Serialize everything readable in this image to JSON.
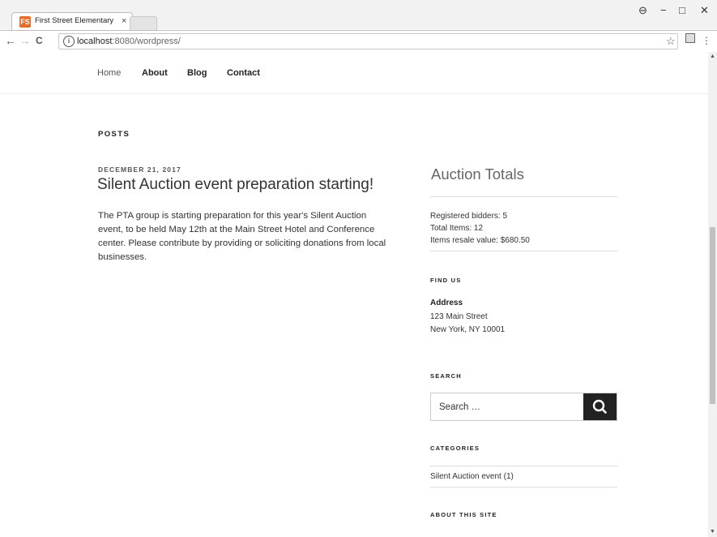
{
  "browser": {
    "tab_title": "First Street Elementary Sc",
    "tab_close": "×",
    "favicon_text": "FS",
    "url_host": "localhost",
    "url_path": ":8080/wordpress/",
    "back_glyph": "←",
    "forward_glyph": "→",
    "reload_glyph": "C",
    "info_glyph": "i",
    "star_glyph": "☆",
    "menu_glyph": "⋮",
    "profile_glyph": "⊖",
    "minimize_glyph": "−",
    "maximize_glyph": "□",
    "close_glyph": "✕"
  },
  "nav": {
    "items": [
      "Home",
      "About",
      "Blog",
      "Contact"
    ]
  },
  "main": {
    "section_title": "POSTS",
    "post": {
      "date": "DECEMBER 21, 2017",
      "title": "Silent Auction event preparation starting!",
      "body": "The PTA group is starting preparation for this year's Silent Auction event, to be held May 12th at the Main Street Hotel and Conference center. Please contribute by providing or soliciting donations from local businesses."
    }
  },
  "sidebar": {
    "auction": {
      "title": "Auction Totals",
      "bidders": "Registered bidders: 5",
      "items": "Total Items: 12",
      "value": "Items resale value: $680.50"
    },
    "find_us": {
      "heading": "FIND US",
      "address_label": "Address",
      "address_line1": "123 Main Street",
      "address_line2": "New York, NY 10001"
    },
    "search": {
      "heading": "SEARCH",
      "placeholder": "Search …"
    },
    "categories": {
      "heading": "CATEGORIES",
      "items": [
        "Silent Auction event (1)"
      ]
    },
    "about": {
      "heading": "ABOUT THIS SITE"
    }
  }
}
